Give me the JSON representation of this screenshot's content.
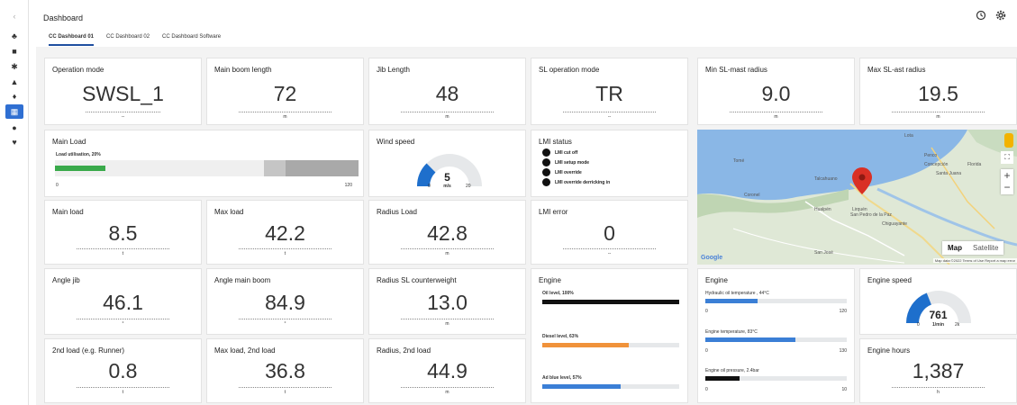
{
  "header": {
    "title": "Dashboard",
    "tabs": [
      {
        "label": "CC Dashboard 01",
        "active": true
      },
      {
        "label": "CC Dashboard 02",
        "active": false
      },
      {
        "label": "CC Dashboard Software",
        "active": false
      }
    ],
    "history_icon": "history-icon",
    "settings_icon": "gear-icon"
  },
  "sidebar": {
    "items": [
      {
        "icon": "chevron-icon",
        "glyph": "‹"
      },
      {
        "icon": "network-icon",
        "glyph": "♣"
      },
      {
        "icon": "grid-icon",
        "glyph": "■"
      },
      {
        "icon": "asterisk-icon",
        "glyph": "✱"
      },
      {
        "icon": "bell-icon",
        "glyph": "▲"
      },
      {
        "icon": "location-icon",
        "glyph": "♦"
      },
      {
        "icon": "dashboard-icon",
        "glyph": "▦",
        "active": true
      },
      {
        "icon": "globe-icon",
        "glyph": "●"
      },
      {
        "icon": "shield-icon",
        "glyph": "♥"
      }
    ]
  },
  "colors": {
    "accent": "#2f6fd2",
    "green": "#3aaa4b",
    "orange": "#f0923a",
    "blue": "#3b7fd6"
  },
  "row1": [
    {
      "title": "Operation mode",
      "value": "SWSL_1",
      "unit": "--"
    },
    {
      "title": "Main boom length",
      "value": "72",
      "unit": "m"
    },
    {
      "title": "Jib Length",
      "value": "48",
      "unit": "m"
    },
    {
      "title": "SL operation mode",
      "value": "TR",
      "unit": "--"
    },
    {
      "title": "Min SL-mast radius",
      "value": "9.0",
      "unit": "m"
    },
    {
      "title": "Max SL-ast radius",
      "value": "19.5",
      "unit": "m"
    }
  ],
  "main_load": {
    "title": "Main Load",
    "label": "Load utilisation, 20%",
    "value": 20,
    "min": "0",
    "max": "120"
  },
  "wind": {
    "title": "Wind speed",
    "value": "5",
    "unit": "m/s",
    "min": "0",
    "max": "20",
    "fraction": 0.25
  },
  "lmi_status": {
    "title": "LMI status",
    "items": [
      "LMI cut off",
      "LMI setup mode",
      "LMI override",
      "LMI override derricking in"
    ]
  },
  "row3": [
    {
      "title": "Main load",
      "value": "8.5",
      "unit": "t"
    },
    {
      "title": "Max load",
      "value": "42.2",
      "unit": "t"
    },
    {
      "title": "Radius Load",
      "value": "42.8",
      "unit": "m"
    },
    {
      "title": "LMI error",
      "value": "0",
      "unit": "--"
    }
  ],
  "map": {
    "map_button": "Map",
    "satellite_button": "Satellite",
    "google": "Google",
    "footer": "Map data ©2022  Terms of Use  Report a map error",
    "places": [
      "Lota",
      "Penco",
      "Concepción",
      "San Pedro de la Paz",
      "Chiguayante",
      "Talcahuano",
      "Hualpén",
      "Tomé",
      "Coronel",
      "Santa Juana",
      "Florida",
      "Lirquén",
      "San José"
    ]
  },
  "row4": [
    {
      "title": "Angle jib",
      "value": "46.1",
      "unit": "°"
    },
    {
      "title": "Angle main boom",
      "value": "84.9",
      "unit": "°"
    },
    {
      "title": "Radius SL counterweight",
      "value": "13.0",
      "unit": "m"
    }
  ],
  "row5": [
    {
      "title": "2nd load (e.g. Runner)",
      "value": "0.8",
      "unit": "t"
    },
    {
      "title": "Max load, 2nd load",
      "value": "36.8",
      "unit": "t"
    },
    {
      "title": "Radius, 2nd load",
      "value": "44.9",
      "unit": "m"
    }
  ],
  "engine_levels": {
    "title": "Engine",
    "bars": [
      {
        "label": "Oil level, 100%",
        "value": 100,
        "color": "#111111"
      },
      {
        "label": "Diesel level, 63%",
        "value": 63,
        "color": "#f0923a"
      },
      {
        "label": "Ad blue level, 57%",
        "value": 57,
        "color": "#3b7fd6"
      }
    ]
  },
  "engine_temps": {
    "title": "Engine",
    "bars": [
      {
        "label": "Hydraulic oil temperature , 44°C",
        "fraction": 0.37,
        "min": "0",
        "max": "120",
        "color": "#3b7fd6"
      },
      {
        "label": "Engine temperature, 83°C",
        "fraction": 0.64,
        "min": "0",
        "max": "130",
        "color": "#3b7fd6"
      },
      {
        "label": "Engine oil pressure, 2.4bar",
        "fraction": 0.24,
        "min": "0",
        "max": "10",
        "color": "#111111"
      }
    ]
  },
  "engine_speed": {
    "title": "Engine speed",
    "value": "761",
    "unit": "1/min",
    "min": "0",
    "max": "2k",
    "fraction": 0.38
  },
  "engine_hours": {
    "title": "Engine hours",
    "value": "1,387",
    "unit": "h"
  }
}
